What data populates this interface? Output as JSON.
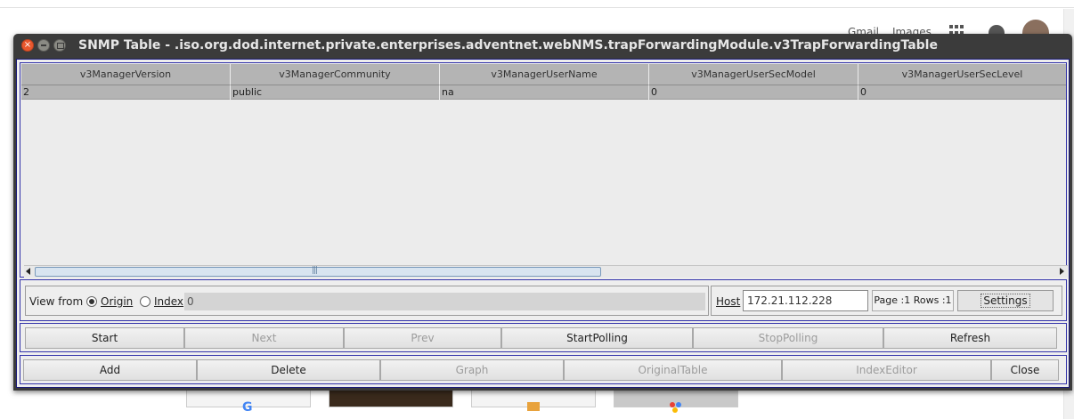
{
  "window": {
    "title": "SNMP Table - .iso.org.dod.internet.private.enterprises.adventnet.webNMS.trapForwardingModule.v3TrapForwardingTable"
  },
  "background": {
    "gmail": "Gmail",
    "images": "Images"
  },
  "table": {
    "columns": [
      "v3ManagerVersion",
      "v3ManagerCommunity",
      "v3ManagerUserName",
      "v3ManagerUserSecModel",
      "v3ManagerUserSecLevel"
    ],
    "rows": [
      [
        "2",
        "public",
        "na",
        "0",
        "0"
      ]
    ]
  },
  "view_from": {
    "label": "View from",
    "options": [
      {
        "label": "Origin",
        "selected": true
      },
      {
        "label": "Index",
        "selected": false
      }
    ],
    "index_value": "0"
  },
  "host": {
    "label": "Host",
    "value": "172.21.112.228",
    "page_rows": "Page :1 Rows :1",
    "settings_label": "Settings"
  },
  "nav_buttons": [
    {
      "label": "Start",
      "enabled": true
    },
    {
      "label": "Next",
      "enabled": false
    },
    {
      "label": "Prev",
      "enabled": false
    },
    {
      "label": "StartPolling",
      "enabled": true
    },
    {
      "label": "StopPolling",
      "enabled": false
    },
    {
      "label": "Refresh",
      "enabled": true
    }
  ],
  "action_buttons": [
    {
      "label": "Add",
      "enabled": true
    },
    {
      "label": "Delete",
      "enabled": true
    },
    {
      "label": "Graph",
      "enabled": false
    },
    {
      "label": "OriginalTable",
      "enabled": false
    },
    {
      "label": "IndexEditor",
      "enabled": false
    },
    {
      "label": "Close",
      "enabled": true
    }
  ]
}
